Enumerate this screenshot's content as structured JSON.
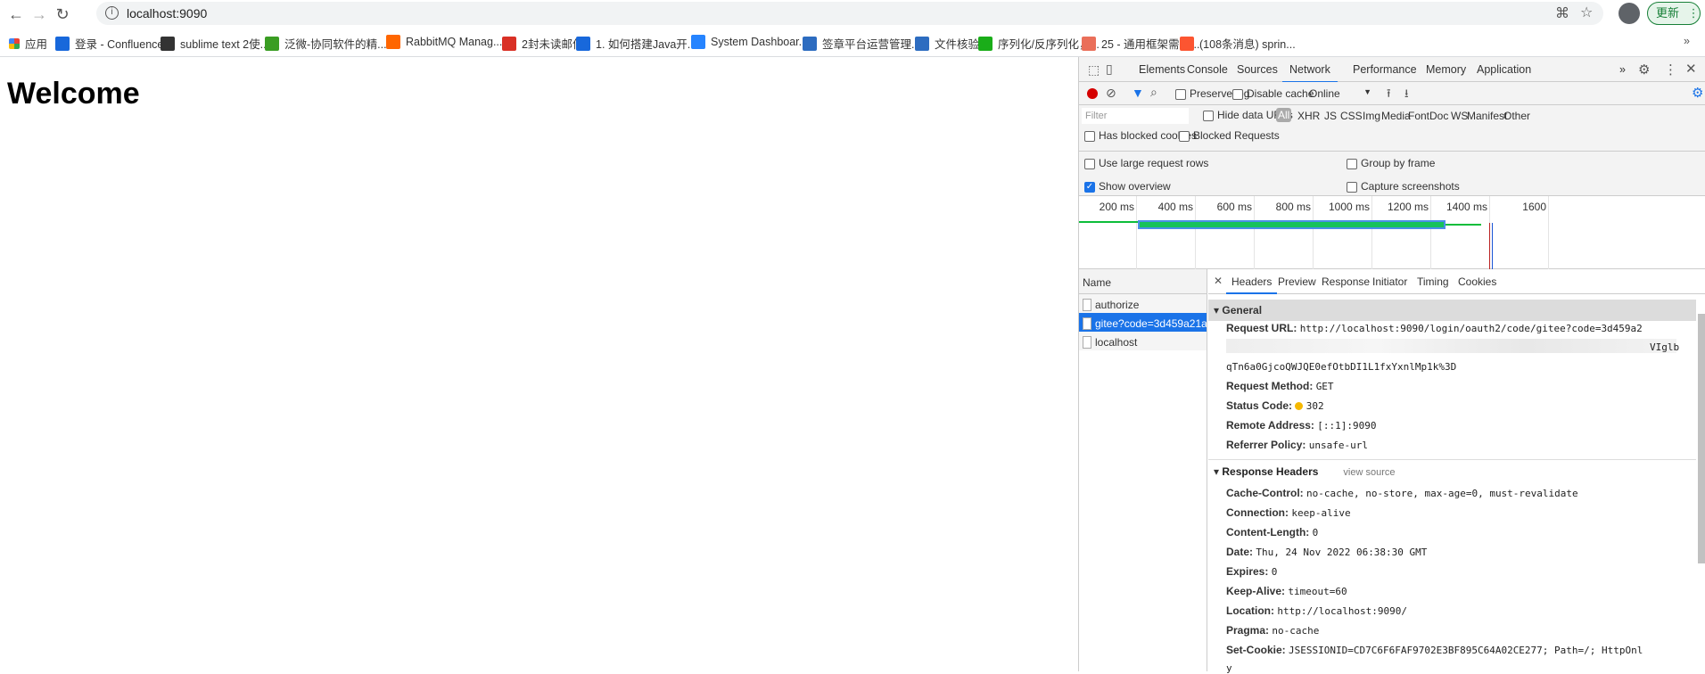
{
  "browser": {
    "url": "localhost:9090",
    "update_label": "更新",
    "bookmarks": [
      {
        "label": "应用",
        "icon": "apps-grid-icon",
        "color": "#ea4335"
      },
      {
        "label": "登录 - Confluence",
        "icon": "confluence-icon",
        "color": "#1868db"
      },
      {
        "label": "sublime text 2使...",
        "icon": "sublime-icon",
        "color": "#333333"
      },
      {
        "label": "泛微-协同软件的精...",
        "icon": "weaver-icon",
        "color": "#3a9d23"
      },
      {
        "label": "RabbitMQ Manag...",
        "icon": "rabbitmq-icon",
        "color": "#ff6600"
      },
      {
        "label": "2封未读邮件",
        "icon": "gmail-icon",
        "color": "#d93025"
      },
      {
        "label": "1. 如何搭建Java开...",
        "icon": "confluence-icon",
        "color": "#1868db"
      },
      {
        "label": "System Dashboar...",
        "icon": "jira-icon",
        "color": "#2684ff"
      },
      {
        "label": "签章平台运营管理...",
        "icon": "q-icon",
        "color": "#2d6cc0"
      },
      {
        "label": "文件核验",
        "icon": "q-icon",
        "color": "#2d6cc0"
      },
      {
        "label": "序列化/反序列化，...",
        "icon": "wechat-icon",
        "color": "#1aad19"
      },
      {
        "label": "25 - 通用框架需求...",
        "icon": "jianshu-icon",
        "color": "#ea6f5a"
      },
      {
        "label": "(108条消息) sprin...",
        "icon": "csdn-icon",
        "color": "#fc5531"
      }
    ],
    "more_bookmarks": "»"
  },
  "page": {
    "heading": "Welcome"
  },
  "devtools": {
    "tabs": [
      "Elements",
      "Console",
      "Sources",
      "Network",
      "Performance",
      "Memory",
      "Application"
    ],
    "active_tab": "Network",
    "more_tabs": "»",
    "toolbar": {
      "preserve_log": "Preserve log",
      "disable_cache": "Disable cache",
      "throttle": "Online"
    },
    "filter": {
      "placeholder": "Filter",
      "hide_data_urls": "Hide data URLs",
      "types": [
        "All",
        "XHR",
        "JS",
        "CSS",
        "Img",
        "Media",
        "Font",
        "Doc",
        "WS",
        "Manifest",
        "Other"
      ],
      "active_type": "All"
    },
    "blocked": {
      "has_blocked_cookies": "Has blocked cookies",
      "blocked_requests": "Blocked Requests"
    },
    "settings": {
      "large_rows": "Use large request rows",
      "group_by_frame": "Group by frame",
      "show_overview": "Show overview",
      "capture_screenshots": "Capture screenshots",
      "show_overview_checked": true
    },
    "overview": {
      "ticks": [
        "200 ms",
        "400 ms",
        "600 ms",
        "800 ms",
        "1000 ms",
        "1200 ms",
        "1400 ms",
        "1600"
      ]
    },
    "requests": {
      "header": "Name",
      "items": [
        "authorize",
        "gitee?code=3d459a21a382c7c...",
        "localhost"
      ],
      "selected": 1
    },
    "detail": {
      "tabs": [
        "Headers",
        "Preview",
        "Response",
        "Initiator",
        "Timing",
        "Cookies"
      ],
      "active": "Headers",
      "general": {
        "title": "General",
        "request_url_label": "Request URL:",
        "request_url": "http://localhost:9090/login/oauth2/code/gitee?code=3d459a2",
        "url_blurred_tail": "VIglb",
        "url_cont": "qTn6a0GjcoQWJQE0efOtbDI1L1fxYxnlMp1k%3D",
        "method_label": "Request Method:",
        "method": "GET",
        "status_label": "Status Code:",
        "status": "302",
        "status_color": "#f5b800",
        "remote_label": "Remote Address:",
        "remote": "[::1]:9090",
        "referrer_label": "Referrer Policy:",
        "referrer": "unsafe-url"
      },
      "response_headers": {
        "title": "Response Headers",
        "view_source": "view source",
        "items": [
          {
            "k": "Cache-Control:",
            "v": "no-cache, no-store, max-age=0, must-revalidate"
          },
          {
            "k": "Connection:",
            "v": "keep-alive"
          },
          {
            "k": "Content-Length:",
            "v": "0"
          },
          {
            "k": "Date:",
            "v": "Thu, 24 Nov 2022 06:38:30 GMT"
          },
          {
            "k": "Expires:",
            "v": "0"
          },
          {
            "k": "Keep-Alive:",
            "v": "timeout=60"
          },
          {
            "k": "Location:",
            "v": "http://localhost:9090/"
          },
          {
            "k": "Pragma:",
            "v": "no-cache"
          },
          {
            "k": "Set-Cookie:",
            "v": "JSESSIONID=CD7C6F6FAF9702E3BF895C64A02CE277; Path=/; HttpOnl"
          }
        ],
        "wrap": "y"
      }
    }
  }
}
